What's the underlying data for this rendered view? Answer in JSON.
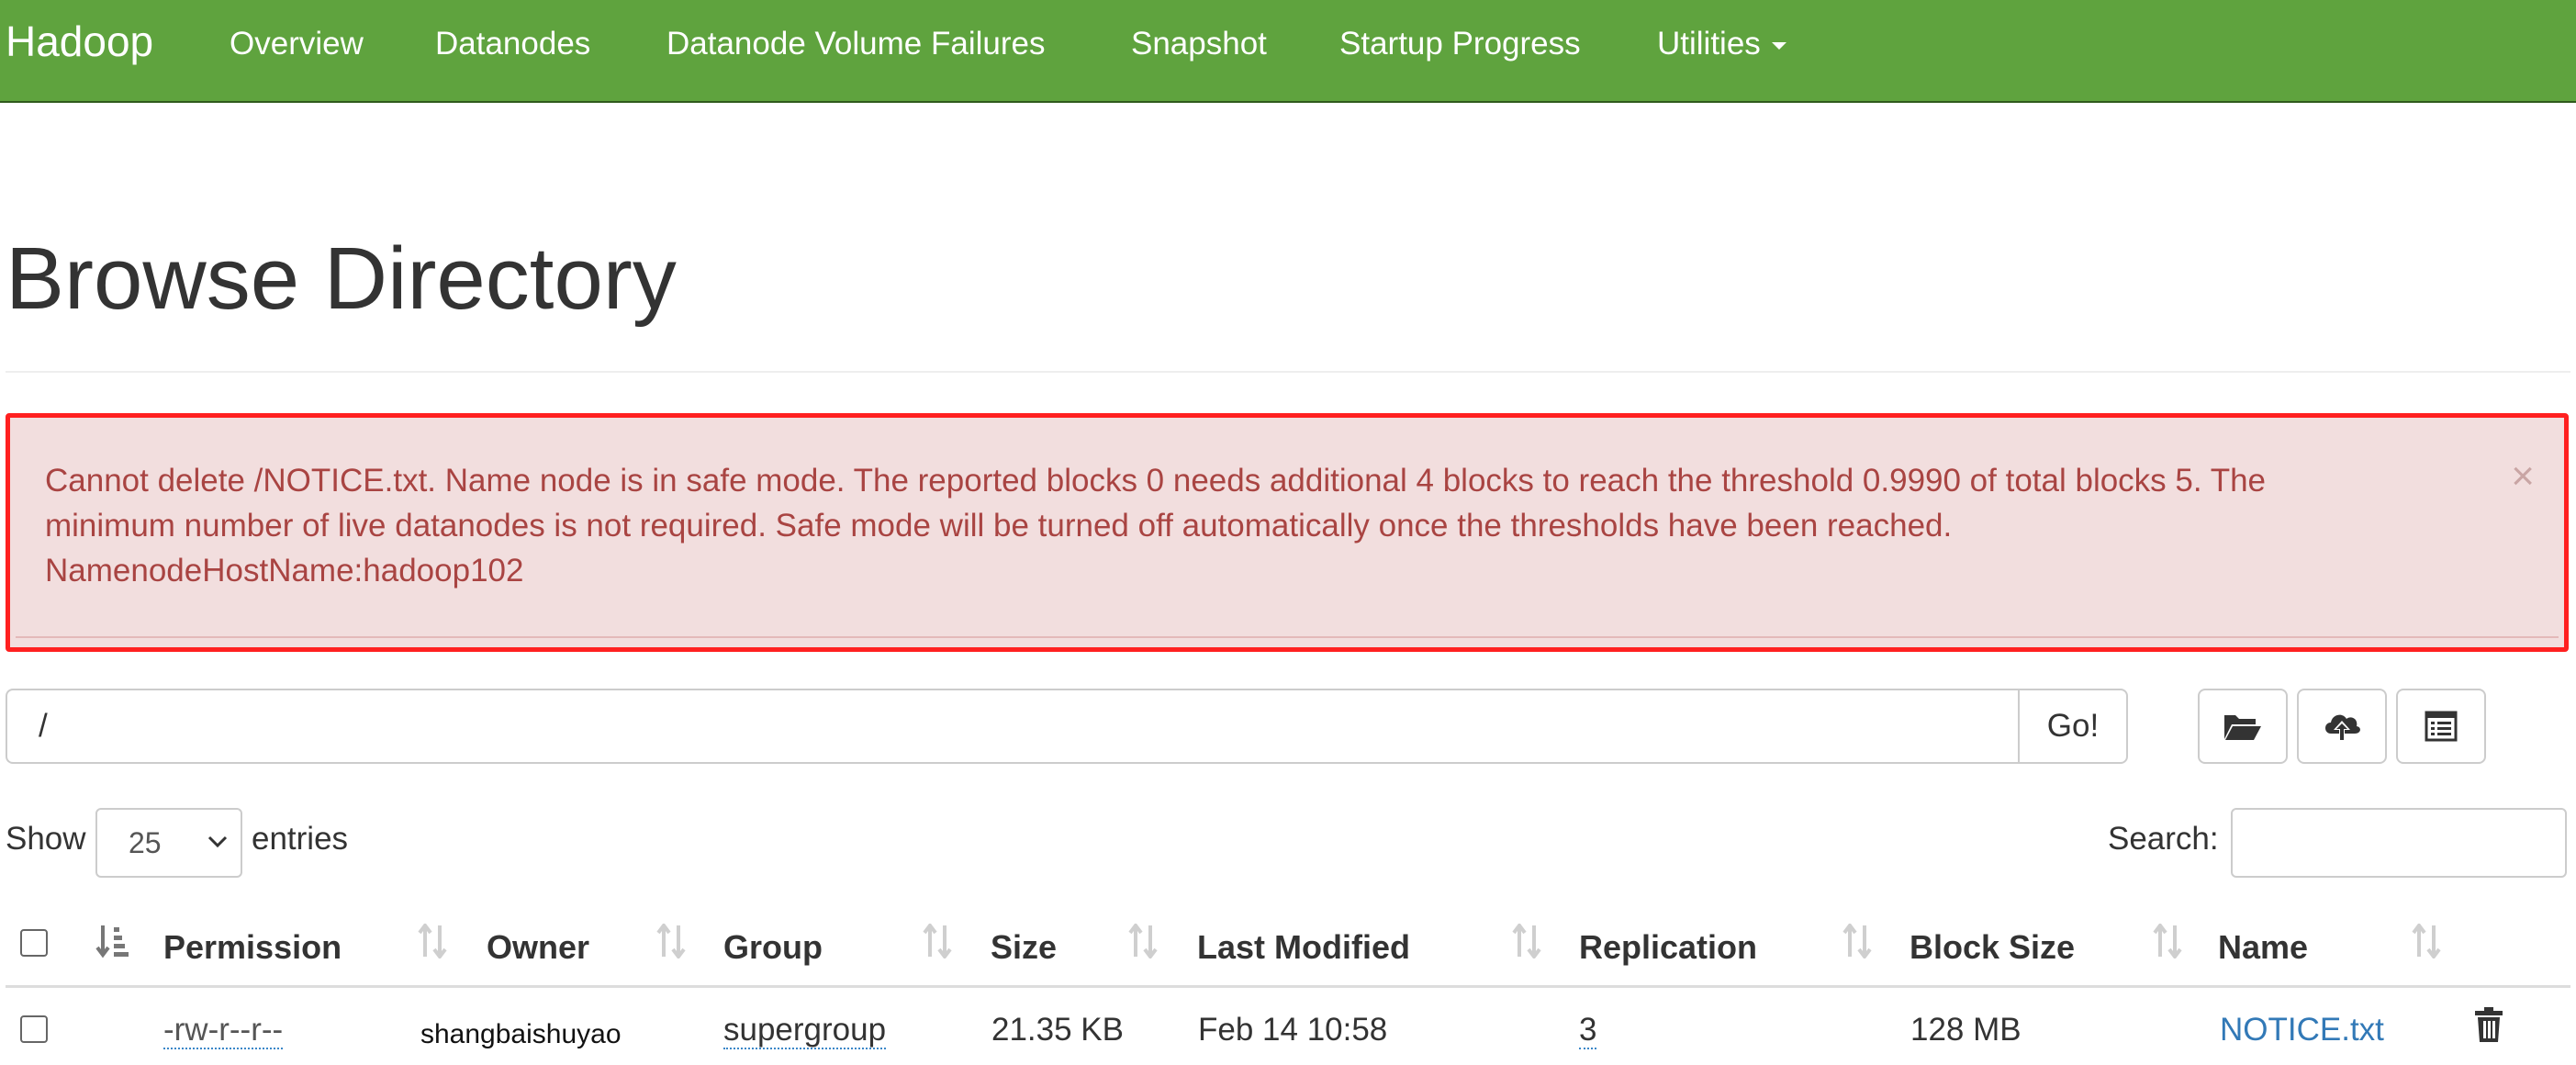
{
  "navbar": {
    "brand": "Hadoop",
    "items": [
      "Overview",
      "Datanodes",
      "Datanode Volume Failures",
      "Snapshot",
      "Startup Progress",
      "Utilities"
    ]
  },
  "page": {
    "title": "Browse Directory"
  },
  "alert": {
    "line1": "Cannot delete /NOTICE.txt. Name node is in safe mode. The reported blocks 0 needs additional 4 blocks to reach the threshold 0.9990 of total blocks 5. The",
    "line2": "minimum number of live datanodes is not required. Safe mode will be turned off automatically once the thresholds have been reached.",
    "line3": "NamenodeHostName:hadoop102",
    "close": "×"
  },
  "path_bar": {
    "value": "/",
    "go_label": "Go!"
  },
  "toolbar_icons": [
    "folder-open-icon",
    "cloud-upload-icon",
    "list-alt-icon"
  ],
  "table_controls": {
    "show_label": "Show",
    "entries_value": "25",
    "entries_label": "entries",
    "search_label": "Search:"
  },
  "table": {
    "columns": [
      "Permission",
      "Owner",
      "Group",
      "Size",
      "Last Modified",
      "Replication",
      "Block Size",
      "Name"
    ],
    "rows": [
      {
        "permission": "-rw-r--r--",
        "owner": "shangbaishuyao",
        "group": "supergroup",
        "size": "21.35 KB",
        "last_modified": "Feb 14 10:58",
        "replication": "3",
        "block_size": "128 MB",
        "name": "NOTICE.txt"
      }
    ]
  },
  "colors": {
    "navbar": "#5fa33e",
    "alert_bg": "#f2dede",
    "alert_text": "#a94442",
    "highlight_border": "#ff2020",
    "link": "#3279b7"
  }
}
